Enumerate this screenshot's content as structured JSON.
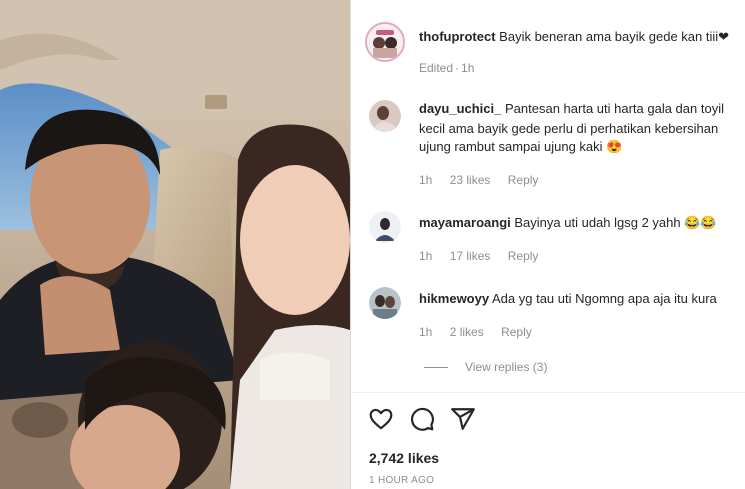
{
  "post": {
    "author": "thofuprotect",
    "caption": "Bayik beneran ama bayik gede kan tiii❤",
    "edited": "Edited",
    "time": "1h"
  },
  "comments": [
    {
      "username": "dayu_uchici_",
      "lines": [
        "Pantesan harta uti harta gala dan toyil",
        "kecil ama bayik gede perlu di perhatikan kebersihan",
        "ujung rambut sampai ujung kaki 😍"
      ],
      "time": "1h",
      "likes": "23 likes",
      "reply": "Reply"
    },
    {
      "username": "mayamaroangi",
      "lines": [
        "Bayinya uti udah lgsg 2 yahh 😂😂"
      ],
      "time": "1h",
      "likes": "17 likes",
      "reply": "Reply"
    },
    {
      "username": "hikmewoyy",
      "lines": [
        "Ada yg tau uti Ngomng apa aja itu kura"
      ],
      "time": "1h",
      "likes": "2 likes",
      "reply": "Reply"
    }
  ],
  "view_replies": "View replies (3)",
  "actions": {
    "like_icon": "heart-icon",
    "comment_icon": "comment-icon",
    "share_icon": "share-icon"
  },
  "likes_count": "2,742 likes",
  "posted_ago": "1 HOUR AGO",
  "colors": {
    "muted": "#8e8e8e",
    "text": "#262626",
    "divider": "#dbdbdb"
  }
}
